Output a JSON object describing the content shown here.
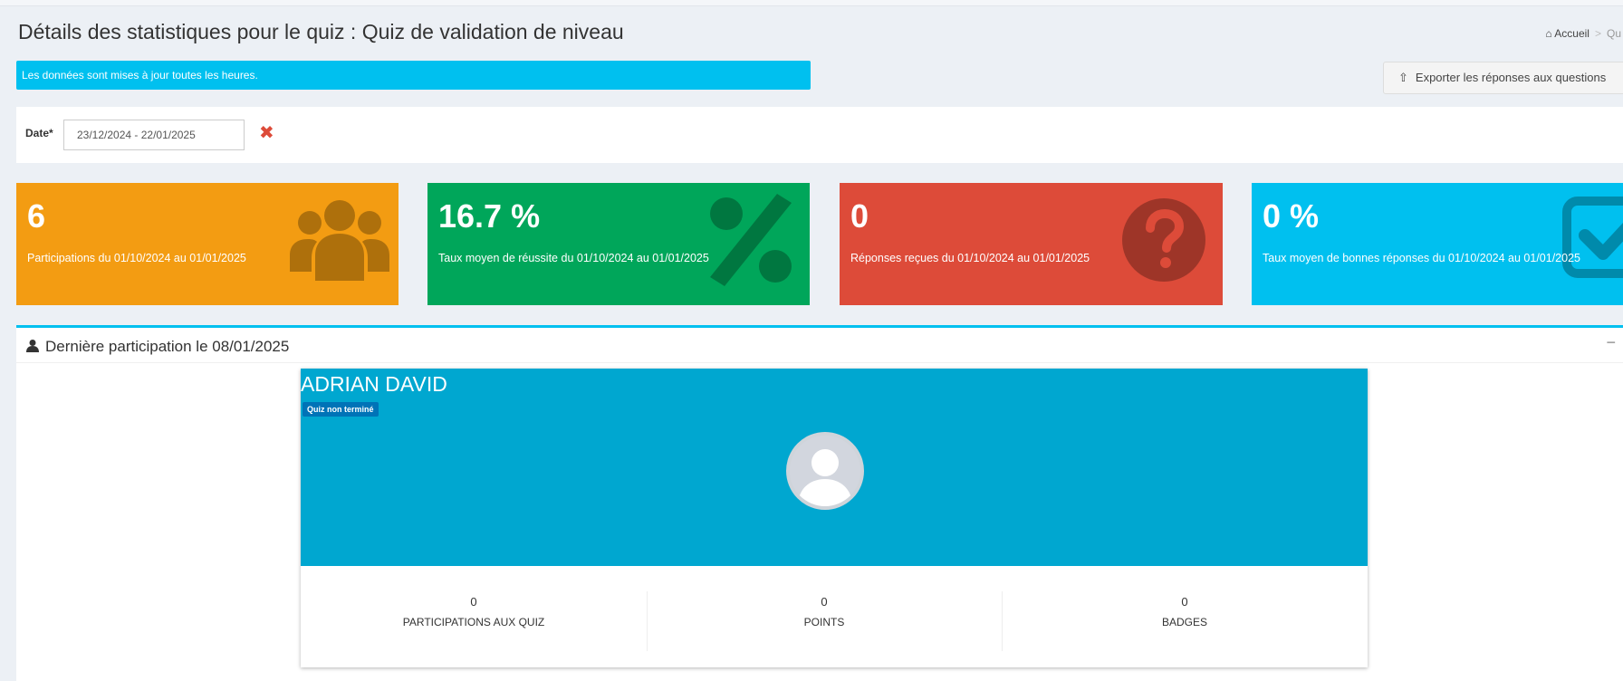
{
  "page": {
    "title": "Détails des statistiques pour le quiz : Quiz de validation de niveau",
    "breadcrumb": {
      "home": "Accueil",
      "current": "Qu"
    }
  },
  "info_bar": {
    "text": "Les données sont mises à jour toutes les heures."
  },
  "export_button": {
    "label": "Exporter les réponses aux questions",
    "icon": "upload-icon"
  },
  "date_filter": {
    "label": "Date*",
    "value": "23/12/2024 - 22/01/2025",
    "clear_icon": "times-icon"
  },
  "stats": [
    {
      "value": "6",
      "description": "Participations du 01/10/2024 au 01/01/2025",
      "color": "#f39c12",
      "icon": "users-icon"
    },
    {
      "value": "16.7 %",
      "description": "Taux moyen de réussite du 01/10/2024 au 01/01/2025",
      "color": "#00a65a",
      "icon": "percent-icon"
    },
    {
      "value": "0",
      "description": "Réponses reçues du 01/10/2024 au 01/01/2025",
      "color": "#dd4b39",
      "icon": "question-circle-icon"
    },
    {
      "value": "0 %",
      "description": "Taux moyen de bonnes réponses du 01/10/2024 au 01/01/2025",
      "color": "#00c0ef",
      "icon": "check-square-icon"
    }
  ],
  "last_participation": {
    "title": "Dernière participation le 08/01/2025",
    "collapse_label": "−",
    "user": {
      "name": "ADRIAN DAVID",
      "status": "Quiz non terminé",
      "stats": [
        {
          "value": "0",
          "label": "PARTICIPATIONS AUX QUIZ"
        },
        {
          "value": "0",
          "label": "POINTS"
        },
        {
          "value": "0",
          "label": "BADGES"
        }
      ]
    }
  }
}
